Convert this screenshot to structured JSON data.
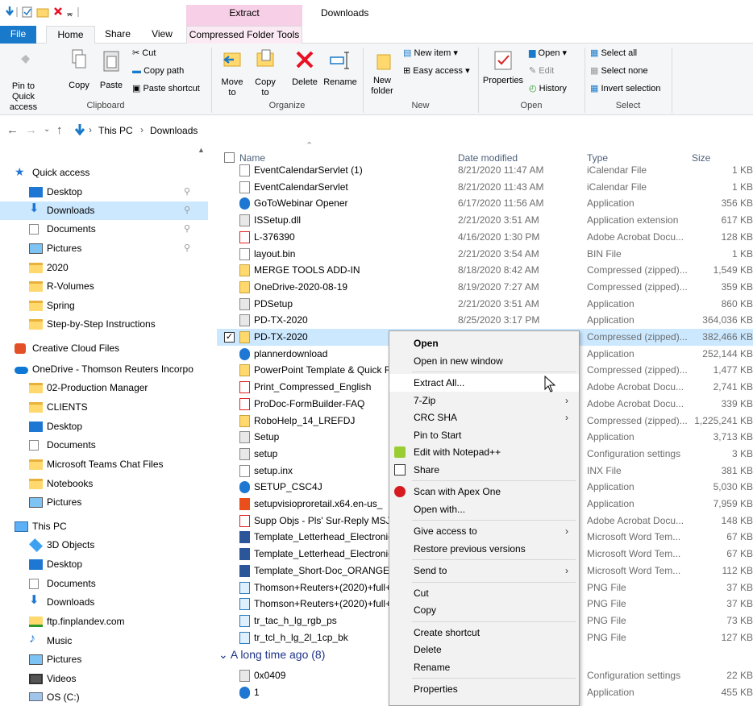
{
  "window": {
    "title": "Downloads",
    "context_title": "Extract"
  },
  "tabs": [
    {
      "label": "File"
    },
    {
      "label": "Home"
    },
    {
      "label": "Share"
    },
    {
      "label": "View"
    },
    {
      "label": "Compressed Folder Tools"
    }
  ],
  "ribbon": {
    "clipboard": {
      "pin": "Pin to Quick access",
      "copy": "Copy",
      "paste": "Paste",
      "cut": "Cut",
      "copy_path": "Copy path",
      "paste_shortcut": "Paste shortcut",
      "group": "Clipboard"
    },
    "organize": {
      "move": "Move to",
      "copy": "Copy to",
      "delete": "Delete",
      "rename": "Rename",
      "group": "Organize"
    },
    "new": {
      "new_folder": "New folder",
      "new_item": "New item",
      "easy_access": "Easy access",
      "group": "New"
    },
    "open": {
      "properties": "Properties",
      "open": "Open",
      "edit": "Edit",
      "history": "History",
      "group": "Open"
    },
    "select": {
      "select_all": "Select all",
      "select_none": "Select none",
      "invert": "Invert selection",
      "group": "Select"
    }
  },
  "address": {
    "crumbs": [
      "This PC",
      "Downloads"
    ]
  },
  "nav": [
    {
      "label": "Quick access",
      "icon": "star-icon"
    },
    {
      "label": "Desktop",
      "icon": "desktop-icon",
      "pinned": true
    },
    {
      "label": "Downloads",
      "icon": "download-icon",
      "pinned": true
    },
    {
      "label": "Documents",
      "icon": "document-icon",
      "pinned": true
    },
    {
      "label": "Pictures",
      "icon": "pictures-icon",
      "pinned": true
    },
    {
      "label": "2020",
      "icon": "folder-icon"
    },
    {
      "label": "R-Volumes",
      "icon": "folder-icon"
    },
    {
      "label": "Spring",
      "icon": "folder-icon"
    },
    {
      "label": "Step-by-Step Instructions",
      "icon": "folder-icon"
    },
    {
      "label": "Creative Cloud Files",
      "icon": "creative-cloud-icon"
    },
    {
      "label": "OneDrive - Thomson Reuters Incorpo",
      "icon": "onedrive-icon"
    },
    {
      "label": "02-Production Manager",
      "icon": "folder-icon"
    },
    {
      "label": "CLIENTS",
      "icon": "folder-icon"
    },
    {
      "label": "Desktop",
      "icon": "desktop-icon"
    },
    {
      "label": "Documents",
      "icon": "document-icon"
    },
    {
      "label": "Microsoft Teams Chat Files",
      "icon": "folder-icon"
    },
    {
      "label": "Notebooks",
      "icon": "folder-icon"
    },
    {
      "label": "Pictures",
      "icon": "pictures-icon"
    },
    {
      "label": "This PC",
      "icon": "computer-icon"
    },
    {
      "label": "3D Objects",
      "icon": "3d-objects-icon"
    },
    {
      "label": "Desktop",
      "icon": "desktop-icon"
    },
    {
      "label": "Documents",
      "icon": "document-icon"
    },
    {
      "label": "Downloads",
      "icon": "download-icon"
    },
    {
      "label": "ftp.finplandev.com",
      "icon": "network-folder-icon"
    },
    {
      "label": "Music",
      "icon": "music-icon"
    },
    {
      "label": "Pictures",
      "icon": "pictures-icon"
    },
    {
      "label": "Videos",
      "icon": "videos-icon"
    },
    {
      "label": "OS (C:)",
      "icon": "drive-icon"
    }
  ],
  "columns": {
    "name": "Name",
    "date": "Date modified",
    "type": "Type",
    "size": "Size"
  },
  "files": [
    {
      "name": "EventCalendarServlet (1)",
      "date": "8/21/2020 11:47 AM",
      "type": "iCalendar File",
      "size": "1 KB",
      "icon": "file"
    },
    {
      "name": "EventCalendarServlet",
      "date": "8/21/2020 11:43 AM",
      "type": "iCalendar File",
      "size": "1 KB",
      "icon": "file"
    },
    {
      "name": "GoToWebinar Opener",
      "date": "6/17/2020 11:56 AM",
      "type": "Application",
      "size": "356 KB",
      "icon": "app"
    },
    {
      "name": "ISSetup.dll",
      "date": "2/21/2020 3:51 AM",
      "type": "Application extension",
      "size": "617 KB",
      "icon": "cfg"
    },
    {
      "name": "L-376390",
      "date": "4/16/2020 1:30 PM",
      "type": "Adobe Acrobat Docu...",
      "size": "128 KB",
      "icon": "pdf"
    },
    {
      "name": "layout.bin",
      "date": "2/21/2020 3:54 AM",
      "type": "BIN File",
      "size": "1 KB",
      "icon": "file"
    },
    {
      "name": "MERGE TOOLS ADD-IN",
      "date": "8/18/2020 8:42 AM",
      "type": "Compressed (zipped)...",
      "size": "1,549 KB",
      "icon": "zip"
    },
    {
      "name": "OneDrive-2020-08-19",
      "date": "8/19/2020 7:27 AM",
      "type": "Compressed (zipped)...",
      "size": "359 KB",
      "icon": "zip"
    },
    {
      "name": "PDSetup",
      "date": "2/21/2020 3:51 AM",
      "type": "Application",
      "size": "860 KB",
      "icon": "cfg"
    },
    {
      "name": "PD-TX-2020",
      "date": "8/25/2020 3:17 PM",
      "type": "Application",
      "size": "364,036 KB",
      "icon": "cfg"
    },
    {
      "name": "PD-TX-2020",
      "date": "",
      "type": "Compressed (zipped)...",
      "size": "382,466 KB",
      "icon": "zip",
      "selected": true
    },
    {
      "name": "plannerdownload",
      "date": "",
      "type": "Application",
      "size": "252,144 KB",
      "icon": "app"
    },
    {
      "name": "PowerPoint Template & Quick R",
      "date": "",
      "type": "Compressed (zipped)...",
      "size": "1,477 KB",
      "icon": "zip"
    },
    {
      "name": "Print_Compressed_English",
      "date": "",
      "type": "Adobe Acrobat Docu...",
      "size": "2,741 KB",
      "icon": "pdf"
    },
    {
      "name": "ProDoc-FormBuilder-FAQ",
      "date": "",
      "type": "Adobe Acrobat Docu...",
      "size": "339 KB",
      "icon": "pdf"
    },
    {
      "name": "RoboHelp_14_LREFDJ",
      "date": "",
      "type": "Compressed (zipped)...",
      "size": "1,225,241 KB",
      "icon": "zip"
    },
    {
      "name": "Setup",
      "date": "",
      "type": "Application",
      "size": "3,713 KB",
      "icon": "cfg"
    },
    {
      "name": "setup",
      "date": "",
      "type": "Configuration settings",
      "size": "3 KB",
      "icon": "cfg"
    },
    {
      "name": "setup.inx",
      "date": "",
      "type": "INX File",
      "size": "381 KB",
      "icon": "file"
    },
    {
      "name": "SETUP_CSC4J",
      "date": "",
      "type": "Application",
      "size": "5,030 KB",
      "icon": "app"
    },
    {
      "name": "setupvisioproretail.x64.en-us_",
      "date": "",
      "type": "Application",
      "size": "7,959 KB",
      "icon": "office"
    },
    {
      "name": "Supp Objs - Pls' Sur-Reply MSJ",
      "date": "",
      "type": "Adobe Acrobat Docu...",
      "size": "148 KB",
      "icon": "pdf"
    },
    {
      "name": "Template_Letterhead_Electronic",
      "date": "",
      "type": "Microsoft Word Tem...",
      "size": "67 KB",
      "icon": "word"
    },
    {
      "name": "Template_Letterhead_Electronic",
      "date": "",
      "type": "Microsoft Word Tem...",
      "size": "67 KB",
      "icon": "word"
    },
    {
      "name": "Template_Short-Doc_ORANGE_l",
      "date": "",
      "type": "Microsoft Word Tem...",
      "size": "112 KB",
      "icon": "word"
    },
    {
      "name": "Thomson+Reuters+(2020)+full+",
      "date": "",
      "type": "PNG File",
      "size": "37 KB",
      "icon": "png"
    },
    {
      "name": "Thomson+Reuters+(2020)+full+",
      "date": "",
      "type": "PNG File",
      "size": "37 KB",
      "icon": "png"
    },
    {
      "name": "tr_tac_h_lg_rgb_ps",
      "date": "",
      "type": "PNG File",
      "size": "73 KB",
      "icon": "png"
    },
    {
      "name": "tr_tcl_h_lg_2l_1cp_bk",
      "date": "",
      "type": "PNG File",
      "size": "127 KB",
      "icon": "png"
    }
  ],
  "group2": {
    "label": "A long time ago (8)"
  },
  "files2": [
    {
      "name": "0x0409",
      "date": "",
      "type": "Configuration settings",
      "size": "22 KB",
      "icon": "cfg"
    },
    {
      "name": "1",
      "date": "",
      "type": "Application",
      "size": "455 KB",
      "icon": "app"
    }
  ],
  "context_menu": [
    {
      "label": "Open",
      "bold": true
    },
    {
      "label": "Open in new window"
    },
    {
      "sep": true
    },
    {
      "label": "Extract All...",
      "highlight": true
    },
    {
      "label": "7-Zip",
      "submenu": true
    },
    {
      "label": "CRC SHA",
      "submenu": true
    },
    {
      "label": "Pin to Start"
    },
    {
      "label": "Edit with Notepad++",
      "icon": "notepadpp-icon"
    },
    {
      "label": "Share",
      "icon": "share-icon"
    },
    {
      "sep": true
    },
    {
      "label": "Scan with Apex One",
      "icon": "apex-one-icon"
    },
    {
      "label": "Open with..."
    },
    {
      "sep": true
    },
    {
      "label": "Give access to",
      "submenu": true
    },
    {
      "label": "Restore previous versions"
    },
    {
      "sep": true
    },
    {
      "label": "Send to",
      "submenu": true
    },
    {
      "sep": true
    },
    {
      "label": "Cut"
    },
    {
      "label": "Copy"
    },
    {
      "sep": true
    },
    {
      "label": "Create shortcut"
    },
    {
      "label": "Delete"
    },
    {
      "label": "Rename"
    },
    {
      "sep": true
    },
    {
      "label": "Properties"
    }
  ],
  "colors": {
    "accent": "#1979ca",
    "selection": "#cce8ff",
    "extract_tab": "#f7cfe6"
  }
}
